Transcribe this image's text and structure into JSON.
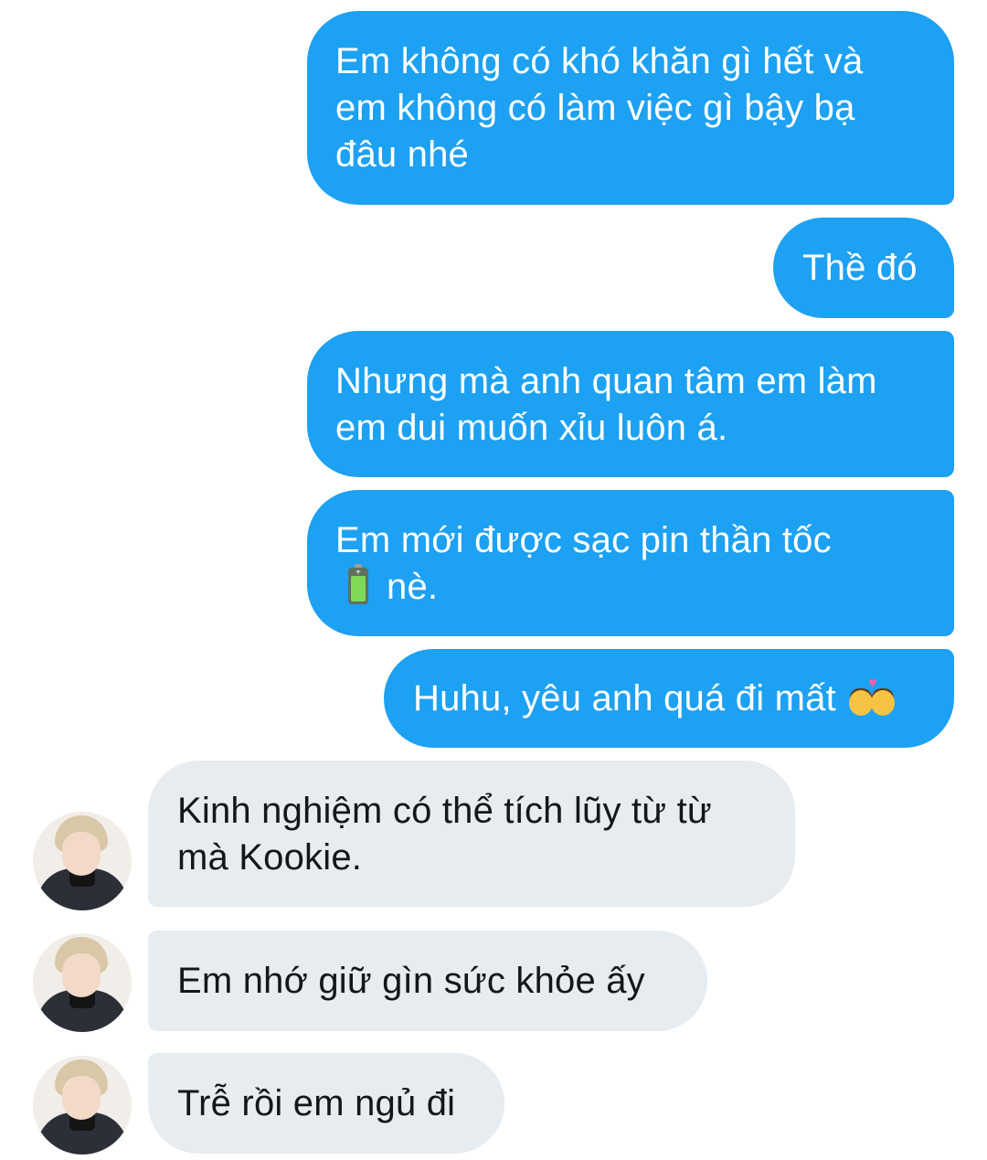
{
  "conversation": {
    "sent": [
      {
        "lines": [
          "Em không có khó khăn gì hết và",
          "em không có làm việc gì bậy bạ",
          "đâu nhé"
        ]
      },
      {
        "lines": [
          "Thề đó"
        ]
      },
      {
        "lines": [
          "Nhưng mà anh quan tâm em làm",
          "em dui muốn xỉu luôn á."
        ]
      },
      {
        "line1": "Em mới được sạc pin thần tốc",
        "line2": "nè.",
        "emoji": "battery-icon"
      },
      {
        "text": "Huhu, yêu anh quá đi mất",
        "emoji": "kiss-icon"
      }
    ],
    "received": [
      {
        "lines": [
          "Kinh nghiệm có thể tích lũy từ từ",
          "mà Kookie."
        ]
      },
      {
        "lines": [
          "Em nhớ giữ gìn sức khỏe ấy"
        ]
      },
      {
        "lines": [
          "Trễ rồi em ngủ đi"
        ]
      }
    ]
  },
  "colors": {
    "sent_bubble": "#1da1f2",
    "sent_text": "#ffffff",
    "received_bubble": "#e6ecf0",
    "received_text": "#14171a",
    "background": "#ffffff"
  }
}
